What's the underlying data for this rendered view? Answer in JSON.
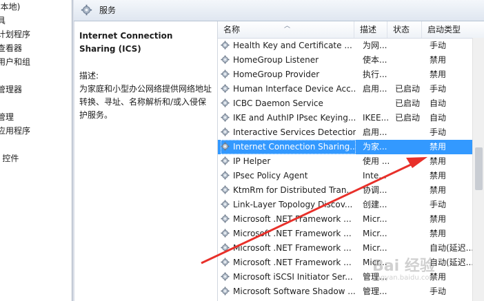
{
  "left_tree": {
    "items": [
      "(本地)",
      "具",
      "计划程序",
      "查看器",
      "用户和组",
      "",
      "管理器",
      "",
      "管理",
      "应用程序",
      "",
      "I 控件"
    ]
  },
  "header": {
    "title": "服务",
    "icon": "gear-icon"
  },
  "description": {
    "service_name": "Internet Connection Sharing (ICS)",
    "label": "描述:",
    "text": "为家庭和小型办公网络提供网络地址转换、寻址、名称解析和/或入侵保护服务。"
  },
  "columns": {
    "name": "名称",
    "desc": "描述",
    "state": "状态",
    "startup": "启动类型"
  },
  "services": [
    {
      "name": "Health Key and Certificate ...",
      "desc": "为网...",
      "state": "",
      "startup": "手动"
    },
    {
      "name": "HomeGroup Listener",
      "desc": "使本...",
      "state": "",
      "startup": "禁用"
    },
    {
      "name": "HomeGroup Provider",
      "desc": "执行...",
      "state": "",
      "startup": "禁用"
    },
    {
      "name": "Human Interface Device Acc...",
      "desc": "启用...",
      "state": "已启动",
      "startup": "手动"
    },
    {
      "name": "ICBC Daemon Service",
      "desc": "",
      "state": "已启动",
      "startup": "自动"
    },
    {
      "name": "IKE and AuthIP IPsec Keying...",
      "desc": "IKEE...",
      "state": "已启动",
      "startup": "自动"
    },
    {
      "name": "Interactive Services Detection",
      "desc": "启用...",
      "state": "",
      "startup": "手动"
    },
    {
      "name": "Internet Connection Sharing...",
      "desc": "为家...",
      "state": "",
      "startup": "禁用",
      "selected": true
    },
    {
      "name": "IP Helper",
      "desc": "使用 ...",
      "state": "",
      "startup": "禁用"
    },
    {
      "name": "IPsec Policy Agent",
      "desc": "Inte...",
      "state": "",
      "startup": "禁用"
    },
    {
      "name": "KtmRm for Distributed Tran...",
      "desc": "协调...",
      "state": "",
      "startup": "禁用"
    },
    {
      "name": "Link-Layer Topology Discov...",
      "desc": "创建...",
      "state": "",
      "startup": "手动"
    },
    {
      "name": "Microsoft .NET Framework ...",
      "desc": "Micr...",
      "state": "",
      "startup": "禁用"
    },
    {
      "name": "Microsoft .NET Framework ...",
      "desc": "Micr...",
      "state": "",
      "startup": "禁用"
    },
    {
      "name": "Microsoft .NET Framework ...",
      "desc": "Micr...",
      "state": "",
      "startup": "自动(延迟..."
    },
    {
      "name": "Microsoft .NET Framework ...",
      "desc": "Micr...",
      "state": "",
      "startup": "自动(延迟..."
    },
    {
      "name": "Microsoft iSCSI Initiator Ser...",
      "desc": "管理...",
      "state": "",
      "startup": "禁用"
    },
    {
      "name": "Microsoft Software Shadow ...",
      "desc": "管理...",
      "state": "",
      "startup": "手动"
    }
  ],
  "watermark": {
    "main": "Bai 经验",
    "sub": "jingyan.baidu.com"
  },
  "colors": {
    "selection": "#3399ff",
    "annotation_arrow": "#e8302a"
  }
}
